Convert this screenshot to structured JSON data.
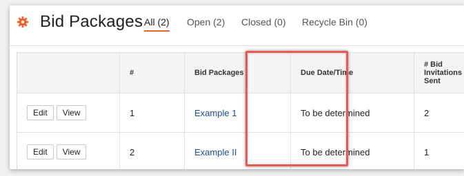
{
  "header": {
    "title": "Bid Packages",
    "icon": "gear-icon",
    "accent_color": "#e8642a"
  },
  "tabs": [
    {
      "label": "All (2)",
      "active": true
    },
    {
      "label": "Open (2)",
      "active": false
    },
    {
      "label": "Closed (0)",
      "active": false
    },
    {
      "label": "Recycle Bin (0)",
      "active": false
    }
  ],
  "table": {
    "columns": [
      "",
      "#",
      "Bid Packages",
      "Due Date/Time",
      "# Bid Invitations Sent"
    ],
    "rows": [
      {
        "edit": "Edit",
        "view": "View",
        "number": "1",
        "name": "Example 1",
        "due": "To be determined",
        "invitations": "2"
      },
      {
        "edit": "Edit",
        "view": "View",
        "number": "2",
        "name": "Example II",
        "due": "To be determined",
        "invitations": "1"
      }
    ]
  },
  "highlight": {
    "target": "Due Date/Time column",
    "color": "#e55b52"
  }
}
